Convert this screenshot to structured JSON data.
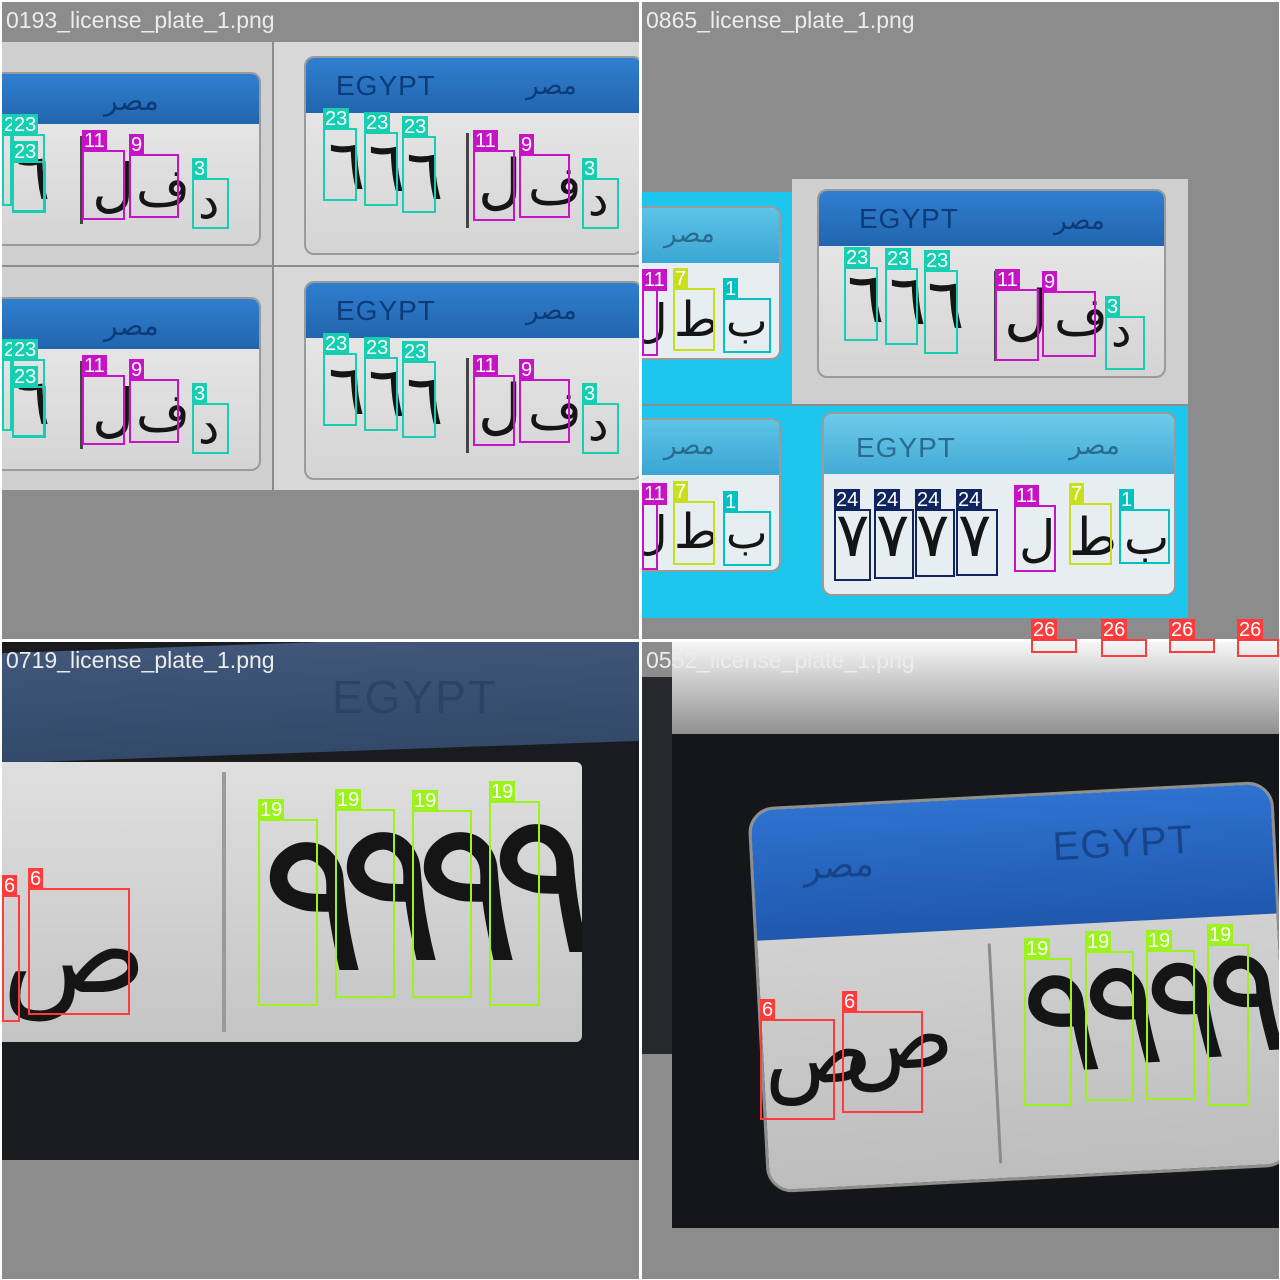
{
  "mosaic": {
    "panels": [
      {
        "filename": "0193_license_plate_1.png"
      },
      {
        "filename": "0865_license_plate_1.png"
      },
      {
        "filename": "0719_license_plate_1.png"
      },
      {
        "filename": "0552_license_plate_1.png"
      }
    ]
  },
  "plates": {
    "egypt_en": "EGYPT",
    "egypt_ar": "مصر",
    "glyphs": {
      "d": "د",
      "f": "ف",
      "l": "ل",
      "six": "٦",
      "seven": "٧",
      "nine": "٩",
      "ta": "ط",
      "ba": "ب",
      "sad": "ص"
    }
  },
  "class_colors": {
    "1": "#00c2c2",
    "3": "#16cfb2",
    "6": "#ff3b3b",
    "7": "#c8e01a",
    "9": "#c613c6",
    "11": "#c613c6",
    "19": "#9bf21c",
    "23": "#16cfb2",
    "24": "#10255f",
    "26": "#ff3b3b"
  },
  "detections": {
    "p0": [
      "23",
      "23",
      "23",
      "11",
      "9",
      "3",
      "23",
      "23",
      "23",
      "11",
      "9",
      "3",
      "23",
      "23",
      "23",
      "11",
      "9",
      "3",
      "23",
      "23",
      "23",
      "11",
      "9",
      "3"
    ],
    "p1": [
      "11",
      "7",
      "1",
      "23",
      "23",
      "23",
      "11",
      "9",
      "3",
      "11",
      "7",
      "1",
      "24",
      "24",
      "24",
      "24",
      "11",
      "7",
      "1",
      "26",
      "26",
      "26",
      "26"
    ],
    "p2": [
      "6",
      "6",
      "19",
      "19",
      "19",
      "19"
    ],
    "p3": [
      "6",
      "6",
      "19",
      "19",
      "19",
      "19"
    ]
  }
}
